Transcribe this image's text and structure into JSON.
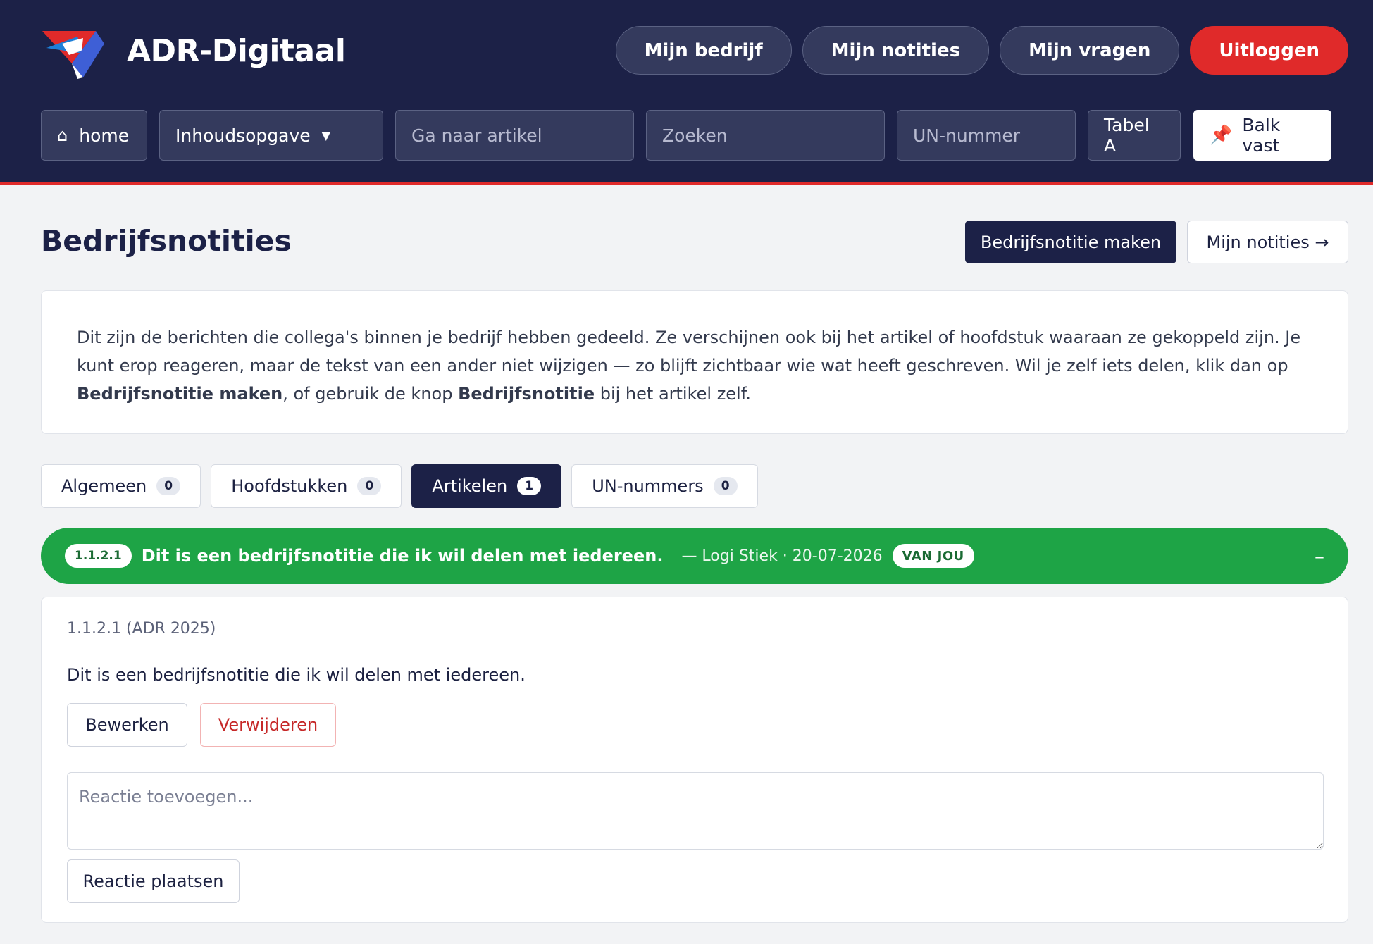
{
  "app": {
    "brand_name": "ADR-Digitaal"
  },
  "topnav": {
    "company": "Mijn bedrijf",
    "notes": "Mijn notities",
    "questions": "Mijn vragen",
    "logout": "Uitloggen"
  },
  "toolbar": {
    "home": "home",
    "toc": "Inhoudsopgave",
    "goto_placeholder": "Ga naar artikel",
    "search_placeholder": "Zoeken",
    "un_placeholder": "UN-nummer",
    "table_a": "Tabel A",
    "pin": "Balk vast"
  },
  "page": {
    "title": "Bedrijfsnotities",
    "create_button": "Bedrijfsnotitie maken",
    "my_notes_button": "Mijn notities →"
  },
  "info": {
    "text1": "Dit zijn de berichten die collega's binnen je bedrijf hebben gedeeld. Ze verschijnen ook bij het artikel of hoofdstuk waaraan ze gekoppeld zijn. Je kunt erop reageren, maar de tekst van een ander niet wijzigen — zo blijft zichtbaar wie wat heeft geschreven. Wil je zelf iets delen, klik dan op ",
    "bold1": "Bedrijfsnotitie maken",
    "text2": ", of gebruik de knop ",
    "bold2": "Bedrijfsnotitie",
    "text3": " bij het artikel zelf."
  },
  "tabs": [
    {
      "label": "Algemeen",
      "count": "0",
      "active": false
    },
    {
      "label": "Hoofdstukken",
      "count": "0",
      "active": false
    },
    {
      "label": "Artikelen",
      "count": "1",
      "active": true
    },
    {
      "label": "UN-nummers",
      "count": "0",
      "active": false
    }
  ],
  "note": {
    "ref": "1.1.2.1",
    "title": "Dit is een bedrijfsnotitie die ik wil delen met iedereen.",
    "meta": "— Logi Stiek · 20-07-2026",
    "badge": "VAN JOU",
    "collapse": "–",
    "ref_line": "1.1.2.1 (ADR 2025)",
    "text": "Dit is een bedrijfsnotitie die ik wil delen met iedereen.",
    "edit": "Bewerken",
    "delete": "Verwijderen",
    "reply_placeholder": "Reactie toevoegen...",
    "post": "Reactie plaatsen"
  },
  "colors": {
    "navy": "#1c2147",
    "accent_red": "#e02a2a",
    "note_green": "#1ea446"
  }
}
